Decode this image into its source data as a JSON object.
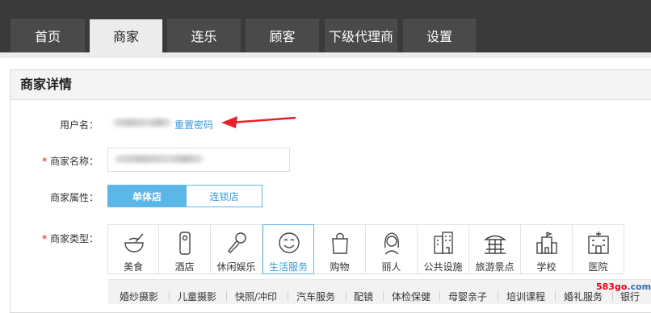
{
  "nav": {
    "tabs": [
      {
        "label": "首页"
      },
      {
        "label": "商家",
        "active": true
      },
      {
        "label": "连乐"
      },
      {
        "label": "顾客"
      },
      {
        "label": "下级代理商"
      },
      {
        "label": "设置"
      }
    ]
  },
  "panel": {
    "title": "商家详情"
  },
  "form": {
    "username_label": "用户名：",
    "reset_password": "重置密码",
    "required_mark": "*",
    "shop_name_label": "商家名称：",
    "attribute_label": "商家属性：",
    "attribute_options": [
      "单体店",
      "连锁店"
    ],
    "attribute_selected": "单体店",
    "type_label": "商家类型："
  },
  "categories": [
    {
      "label": "美食",
      "icon": "bowl-icon"
    },
    {
      "label": "酒店",
      "icon": "door-hanger-icon"
    },
    {
      "label": "休闲娱乐",
      "icon": "microphone-icon"
    },
    {
      "label": "生活服务",
      "icon": "smiley-icon",
      "selected": true
    },
    {
      "label": "购物",
      "icon": "shopping-bag-icon"
    },
    {
      "label": "丽人",
      "icon": "woman-icon"
    },
    {
      "label": "公共设施",
      "icon": "building-icon"
    },
    {
      "label": "旅游景点",
      "icon": "temple-icon"
    },
    {
      "label": "学校",
      "icon": "school-icon"
    },
    {
      "label": "医院",
      "icon": "hospital-icon"
    }
  ],
  "subcategories": [
    "婚纱摄影",
    "儿童摄影",
    "快照/冲印",
    "汽车服务",
    "配镜",
    "体检保健",
    "母婴亲子",
    "培训课程",
    "婚礼服务",
    "银行"
  ],
  "watermark": {
    "red": "583go",
    "blue": ".com"
  },
  "colors": {
    "accent": "#5ab7e8",
    "link": "#3a9ad9",
    "required": "#e60012",
    "nav_bg": "#3a3a3a",
    "tab_active_bg": "#ececec"
  }
}
